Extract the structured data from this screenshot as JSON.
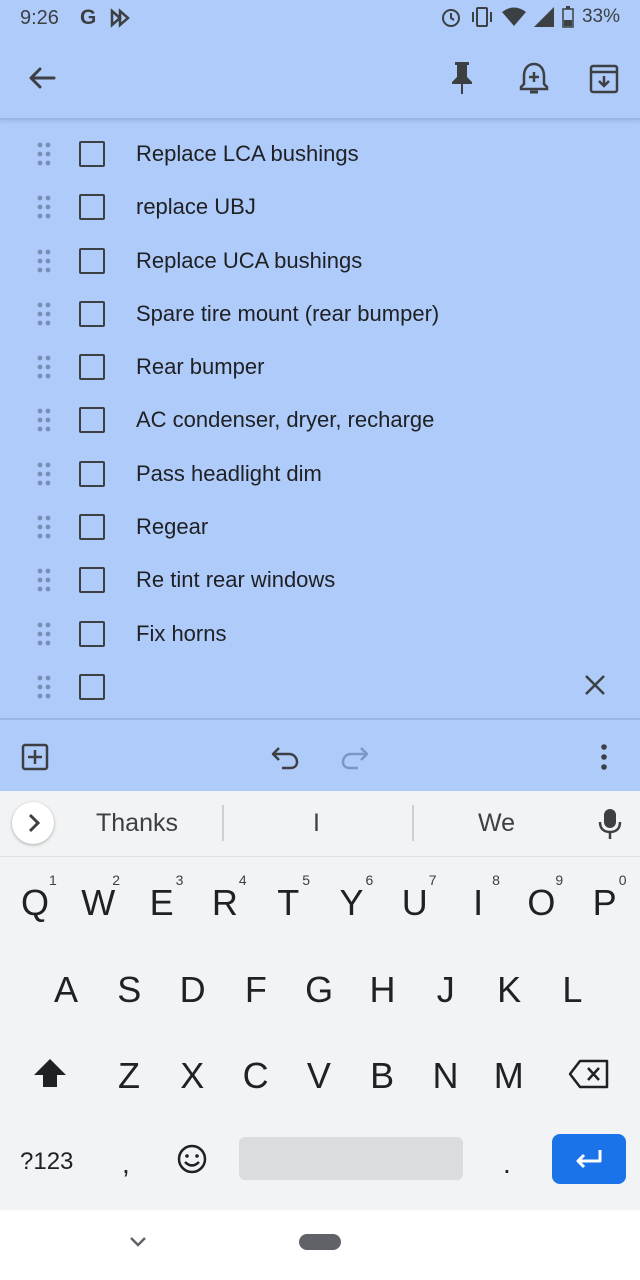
{
  "status_bar": {
    "time": "9:26",
    "google_letter": "G",
    "battery_percent": "33%"
  },
  "toolbar": {
    "back_icon": "arrow-back-icon",
    "pin_icon": "pin-icon",
    "reminder_icon": "add-reminder-icon",
    "archive_icon": "archive-icon"
  },
  "checklist": {
    "items": [
      {
        "label": "Replace LCA bushings",
        "checked": false
      },
      {
        "label": "replace UBJ",
        "checked": false
      },
      {
        "label": "Replace UCA bushings",
        "checked": false
      },
      {
        "label": "Spare tire mount (rear bumper)",
        "checked": false
      },
      {
        "label": "Rear bumper",
        "checked": false
      },
      {
        "label": "AC condenser, dryer, recharge",
        "checked": false
      },
      {
        "label": "Pass headlight dim",
        "checked": false
      },
      {
        "label": "Regear",
        "checked": false
      },
      {
        "label": "Re tint rear windows",
        "checked": false
      },
      {
        "label": "Fix horns",
        "checked": false
      }
    ],
    "new_item_value": ""
  },
  "keyboard": {
    "suggestions": [
      "Thanks",
      "I",
      "We"
    ],
    "row1": [
      [
        "Q",
        "1"
      ],
      [
        "W",
        "2"
      ],
      [
        "E",
        "3"
      ],
      [
        "R",
        "4"
      ],
      [
        "T",
        "5"
      ],
      [
        "Y",
        "6"
      ],
      [
        "U",
        "7"
      ],
      [
        "I",
        "8"
      ],
      [
        "O",
        "9"
      ],
      [
        "P",
        "0"
      ]
    ],
    "row2": [
      "A",
      "S",
      "D",
      "F",
      "G",
      "H",
      "J",
      "K",
      "L"
    ],
    "row3": [
      "Z",
      "X",
      "C",
      "V",
      "B",
      "N",
      "M"
    ],
    "symbols_label": "?123",
    "comma": ",",
    "period": "."
  },
  "colors": {
    "note_background": "#aecbfa",
    "enter_key": "#1a73e8"
  }
}
